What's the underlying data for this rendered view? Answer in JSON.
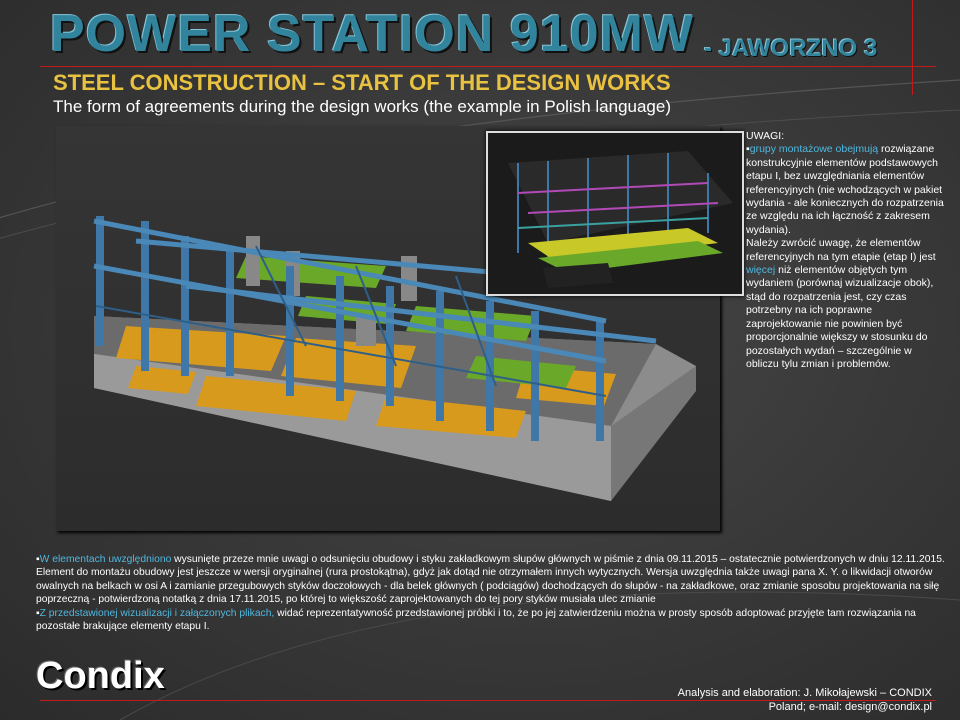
{
  "title": {
    "main": "POWER STATION 910MW",
    "sub": "- JAWORZNO 3"
  },
  "heading": "STEEL CONSTRUCTION – START OF  THE DESIGN WORKS",
  "subheading": "The form of agreements during the design works (the example in Polish language)",
  "notes": {
    "title": "UWAGI:",
    "p1_hl": "grupy montażowe obejmują",
    "p1_rest": " rozwiązane konstrukcyjnie elementów podstawowych etapu I, bez uwzględniania elementów referencyjnych (nie wchodzących w pakiet wydania  - ale koniecznych do rozpatrzenia ze względu na ich łączność z zakresem wydania).",
    "p2_a": "Należy zwrócić uwagę, że elementów referencyjnych na tym etapie (etap I) jest ",
    "p2_hl": "więcej",
    "p2_b": " niż elementów objętych  tym wydaniem (porównaj wizualizacje obok), stąd do rozpatrzenia jest, czy czas potrzebny na ich poprawne zaprojektowanie nie powinien być  proporcjonalnie większy w stosunku do pozostałych wydań – szczególnie w obliczu tylu zmian i problemów."
  },
  "bullets": {
    "b1_hl": "W elementach uwzględniono",
    "b1_rest": " wysunięte przeze mnie uwagi o odsunięciu obudowy i styku zakładkowym słupów głównych w piśmie z dnia 09.11.2015 – ostatecznie potwierdzonych w dniu 12.11.2015. Element  do montażu obudowy jest jeszcze w wersji oryginalnej (rura prostokątna), gdyż jak dotąd nie otrzymałem innych wytycznych. Wersja uwzględnia także uwagi pana X. Y.   o likwidacji otworów owalnych na belkach w osi A   i zamianie przegubowych styków doczołowych - dla belek głównych ( podciągów) dochodzących do słupów - na zakładkowe, oraz zmianie sposobu projektowania na siłę poprzeczną - potwierdzoną notatką z dnia 17.11.2015, po której to większość zaprojektowanych do tej pory styków musiała ulec zmianie",
    "b2_hl": "Z przedstawionej wizualizacji i załączonych plikach,",
    "b2_rest": " widać reprezentatywność przedstawionej próbki i to, że po jej zatwierdzeniu można w  prosty sposób adoptować przyjęte tam rozwiązania na pozostałe brakujące elementy etapu I."
  },
  "logo": "Condix",
  "credit": {
    "line1": "Analysis and elaboration: J. Mikołajewski – CONDIX",
    "line2": "Poland; e-mail: design@condix.pl"
  },
  "colors": {
    "title": "#31849b",
    "heading": "#e8c240",
    "highlight": "#4fb8e0",
    "accent_line": "#c21a1a",
    "steel": "#3f78a8",
    "grating_orange": "#d89a1c",
    "grating_green": "#6aa82a"
  }
}
